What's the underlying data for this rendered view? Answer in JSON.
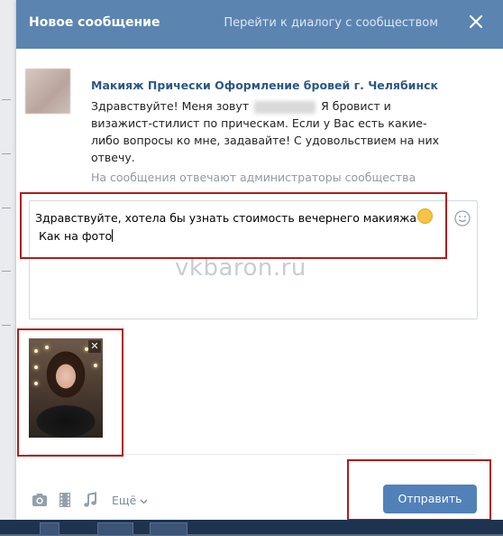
{
  "modal": {
    "title": "Новое сообщение",
    "goto_dialog": "Перейти к диалогу с сообществом",
    "close_icon": "close-icon"
  },
  "community": {
    "name": "Макияж Прически Оформление бровей г. Челябинск",
    "greeting_part1": "Здравствуйте! Меня зовут",
    "greeting_part2": "Я бровист и визажист-стилист по прическам. Если у Вас есть какие-либо вопросы ко мне, задавайте! С удовольствием на них отвечу.",
    "admins_note": "На сообщения отвечают администраторы сообщества"
  },
  "composer": {
    "line1": "Здравствуйте, хотела бы узнать стоимость вечернего макияжа",
    "line2": "Как на фото",
    "emoji_button_icon": "smile-icon"
  },
  "watermark": "vkbaron.ru",
  "attachment": {
    "remove_label": "✕"
  },
  "toolbar": {
    "photo_icon": "camera-icon",
    "video_icon": "film-icon",
    "audio_icon": "music-note-icon",
    "more_label": "Ещё",
    "more_icon": "chevron-down-icon"
  },
  "send_button": "Отправить",
  "colors": {
    "header": "#5b84b1",
    "link": "#2a5885",
    "send": "#5181b8",
    "annotation": "#b01c1c"
  }
}
